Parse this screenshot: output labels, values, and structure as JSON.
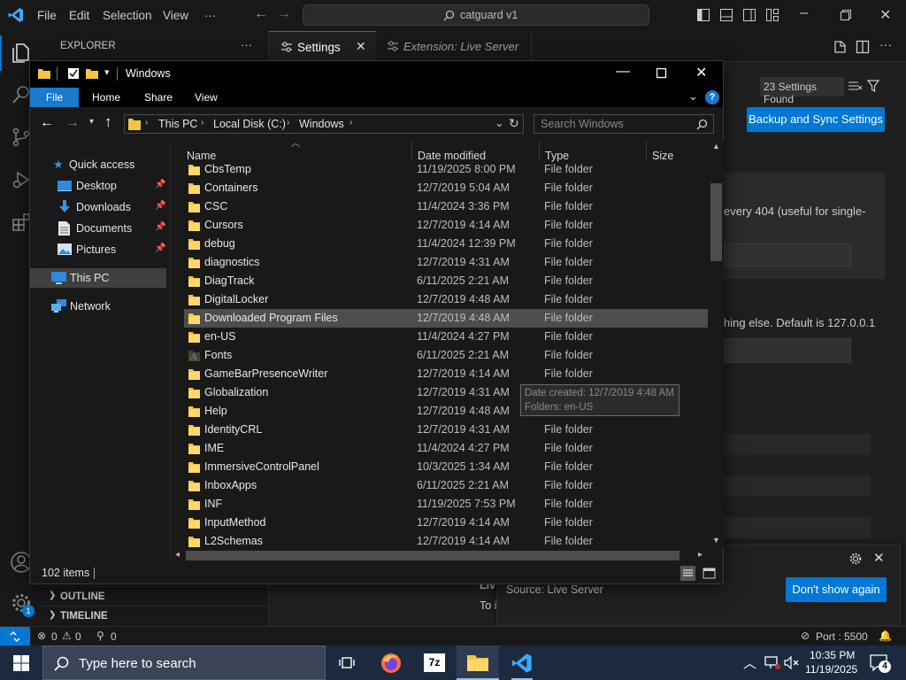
{
  "vscode": {
    "menu": [
      "File",
      "Edit",
      "Selection",
      "View",
      "···"
    ],
    "command_center": "catguard v1",
    "sidebar_title": "EXPLORER",
    "sidebar_more": "···",
    "outline": "OUTLINE",
    "timeline": "TIMELINE",
    "tab_settings": "Settings",
    "tab_extension": "Extension: Live Server",
    "settings_found": "23 Settings Found",
    "backup_sync": "Backup and Sync Settings",
    "setting_text_1": "every 404 (useful for single-",
    "setting_text_2": "hing else. Default is 127.0.0.1",
    "partial_text_1": "Liv",
    "partial_text_2": "To i",
    "notification_source": "Source: Live Server",
    "dont_show_again": "Don't show again",
    "status_errors": "0",
    "status_warnings": "0",
    "status_ports": "0",
    "status_port": "Port : 5500",
    "accounts_badge": "1"
  },
  "explorer": {
    "title": "Windows",
    "ribbon_tabs": [
      "File",
      "Home",
      "Share",
      "View"
    ],
    "breadcrumb": [
      "This PC",
      "Local Disk (C:)",
      "Windows"
    ],
    "search_placeholder": "Search Windows",
    "nav": {
      "quick_access": "Quick access",
      "desktop": "Desktop",
      "downloads": "Downloads",
      "documents": "Documents",
      "pictures": "Pictures",
      "this_pc": "This PC",
      "network": "Network"
    },
    "columns": [
      "Name",
      "Date modified",
      "Type",
      "Size"
    ],
    "files": [
      {
        "name": "CbsTemp",
        "date": "11/19/2025 8:00 PM",
        "type": "File folder"
      },
      {
        "name": "Containers",
        "date": "12/7/2019 5:04 AM",
        "type": "File folder"
      },
      {
        "name": "CSC",
        "date": "11/4/2024 3:36 PM",
        "type": "File folder"
      },
      {
        "name": "Cursors",
        "date": "12/7/2019 4:14 AM",
        "type": "File folder"
      },
      {
        "name": "debug",
        "date": "11/4/2024 12:39 PM",
        "type": "File folder"
      },
      {
        "name": "diagnostics",
        "date": "12/7/2019 4:31 AM",
        "type": "File folder"
      },
      {
        "name": "DiagTrack",
        "date": "6/11/2025 2:21 AM",
        "type": "File folder"
      },
      {
        "name": "DigitalLocker",
        "date": "12/7/2019 4:48 AM",
        "type": "File folder"
      },
      {
        "name": "Downloaded Program Files",
        "date": "12/7/2019 4:48 AM",
        "type": "File folder"
      },
      {
        "name": "en-US",
        "date": "11/4/2024 4:27 PM",
        "type": "File folder"
      },
      {
        "name": "Fonts",
        "date": "6/11/2025 2:21 AM",
        "type": "File folder"
      },
      {
        "name": "GameBarPresenceWriter",
        "date": "12/7/2019 4:14 AM",
        "type": "File folder"
      },
      {
        "name": "Globalization",
        "date": "12/7/2019 4:31 AM",
        "type": "File folder"
      },
      {
        "name": "Help",
        "date": "12/7/2019 4:48 AM",
        "type": "File folder"
      },
      {
        "name": "IdentityCRL",
        "date": "12/7/2019 4:31 AM",
        "type": "File folder"
      },
      {
        "name": "IME",
        "date": "11/4/2024 4:27 PM",
        "type": "File folder"
      },
      {
        "name": "ImmersiveControlPanel",
        "date": "10/3/2025 1:34 AM",
        "type": "File folder"
      },
      {
        "name": "InboxApps",
        "date": "6/11/2025 2:21 AM",
        "type": "File folder"
      },
      {
        "name": "INF",
        "date": "11/19/2025 7:53 PM",
        "type": "File folder"
      },
      {
        "name": "InputMethod",
        "date": "12/7/2019 4:14 AM",
        "type": "File folder"
      },
      {
        "name": "L2Schemas",
        "date": "12/7/2019 4:14 AM",
        "type": "File folder"
      }
    ],
    "tooltip": {
      "date": "Date created: 12/7/2019 4:48 AM",
      "folders": "Folders: en-US"
    },
    "item_count": "102 items"
  },
  "taskbar": {
    "search_placeholder": "Type here to search",
    "time": "10:35 PM",
    "date": "11/19/2025",
    "notifications": "4"
  },
  "colors": {
    "accent": "#0078d4",
    "folder": "#f4c542",
    "file_tab": "#1979ca"
  }
}
